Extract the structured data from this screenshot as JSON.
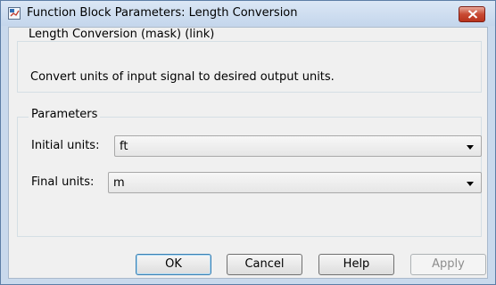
{
  "window": {
    "title": "Function Block Parameters: Length Conversion"
  },
  "block": {
    "mask_label": "Length Conversion (mask) (link)",
    "description": "Convert units of input signal to desired output units."
  },
  "parameters": {
    "group_label": "Parameters",
    "initial_units": {
      "label": "Initial units:",
      "value": "ft"
    },
    "final_units": {
      "label": "Final units:",
      "value": "m"
    }
  },
  "buttons": {
    "ok": "OK",
    "cancel": "Cancel",
    "help": "Help",
    "apply": "Apply"
  }
}
